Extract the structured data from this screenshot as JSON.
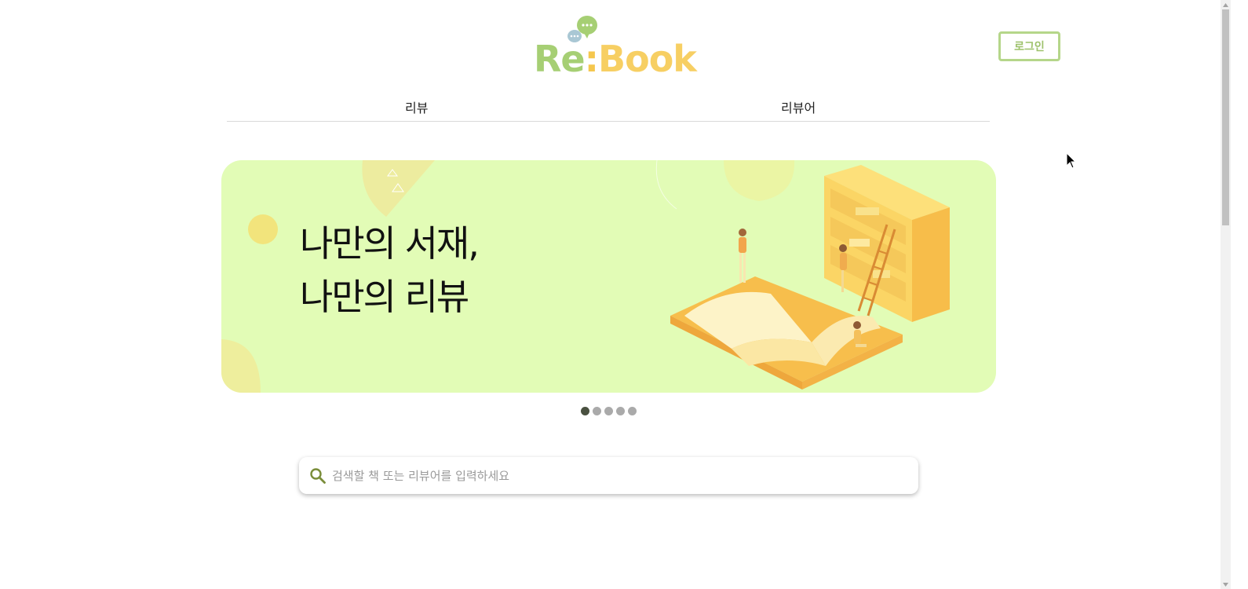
{
  "header": {
    "logo": {
      "re": "Re",
      "colon": ":",
      "book": "Book"
    },
    "login_label": "로그인"
  },
  "nav": {
    "items": [
      {
        "label": "리뷰"
      },
      {
        "label": "리뷰어"
      }
    ]
  },
  "banner": {
    "line1": "나만의 서재,",
    "line2": "나만의 리뷰",
    "background": "#e2fcb6"
  },
  "carousel": {
    "total": 5,
    "active_index": 0
  },
  "search": {
    "placeholder": "검색할 책 또는 리뷰어를 입력하세요",
    "value": ""
  },
  "section_peek": "",
  "colors": {
    "brand_green": "#a6cf74",
    "brand_yellow": "#f7cf63",
    "banner_bg": "#e2fcb6"
  }
}
